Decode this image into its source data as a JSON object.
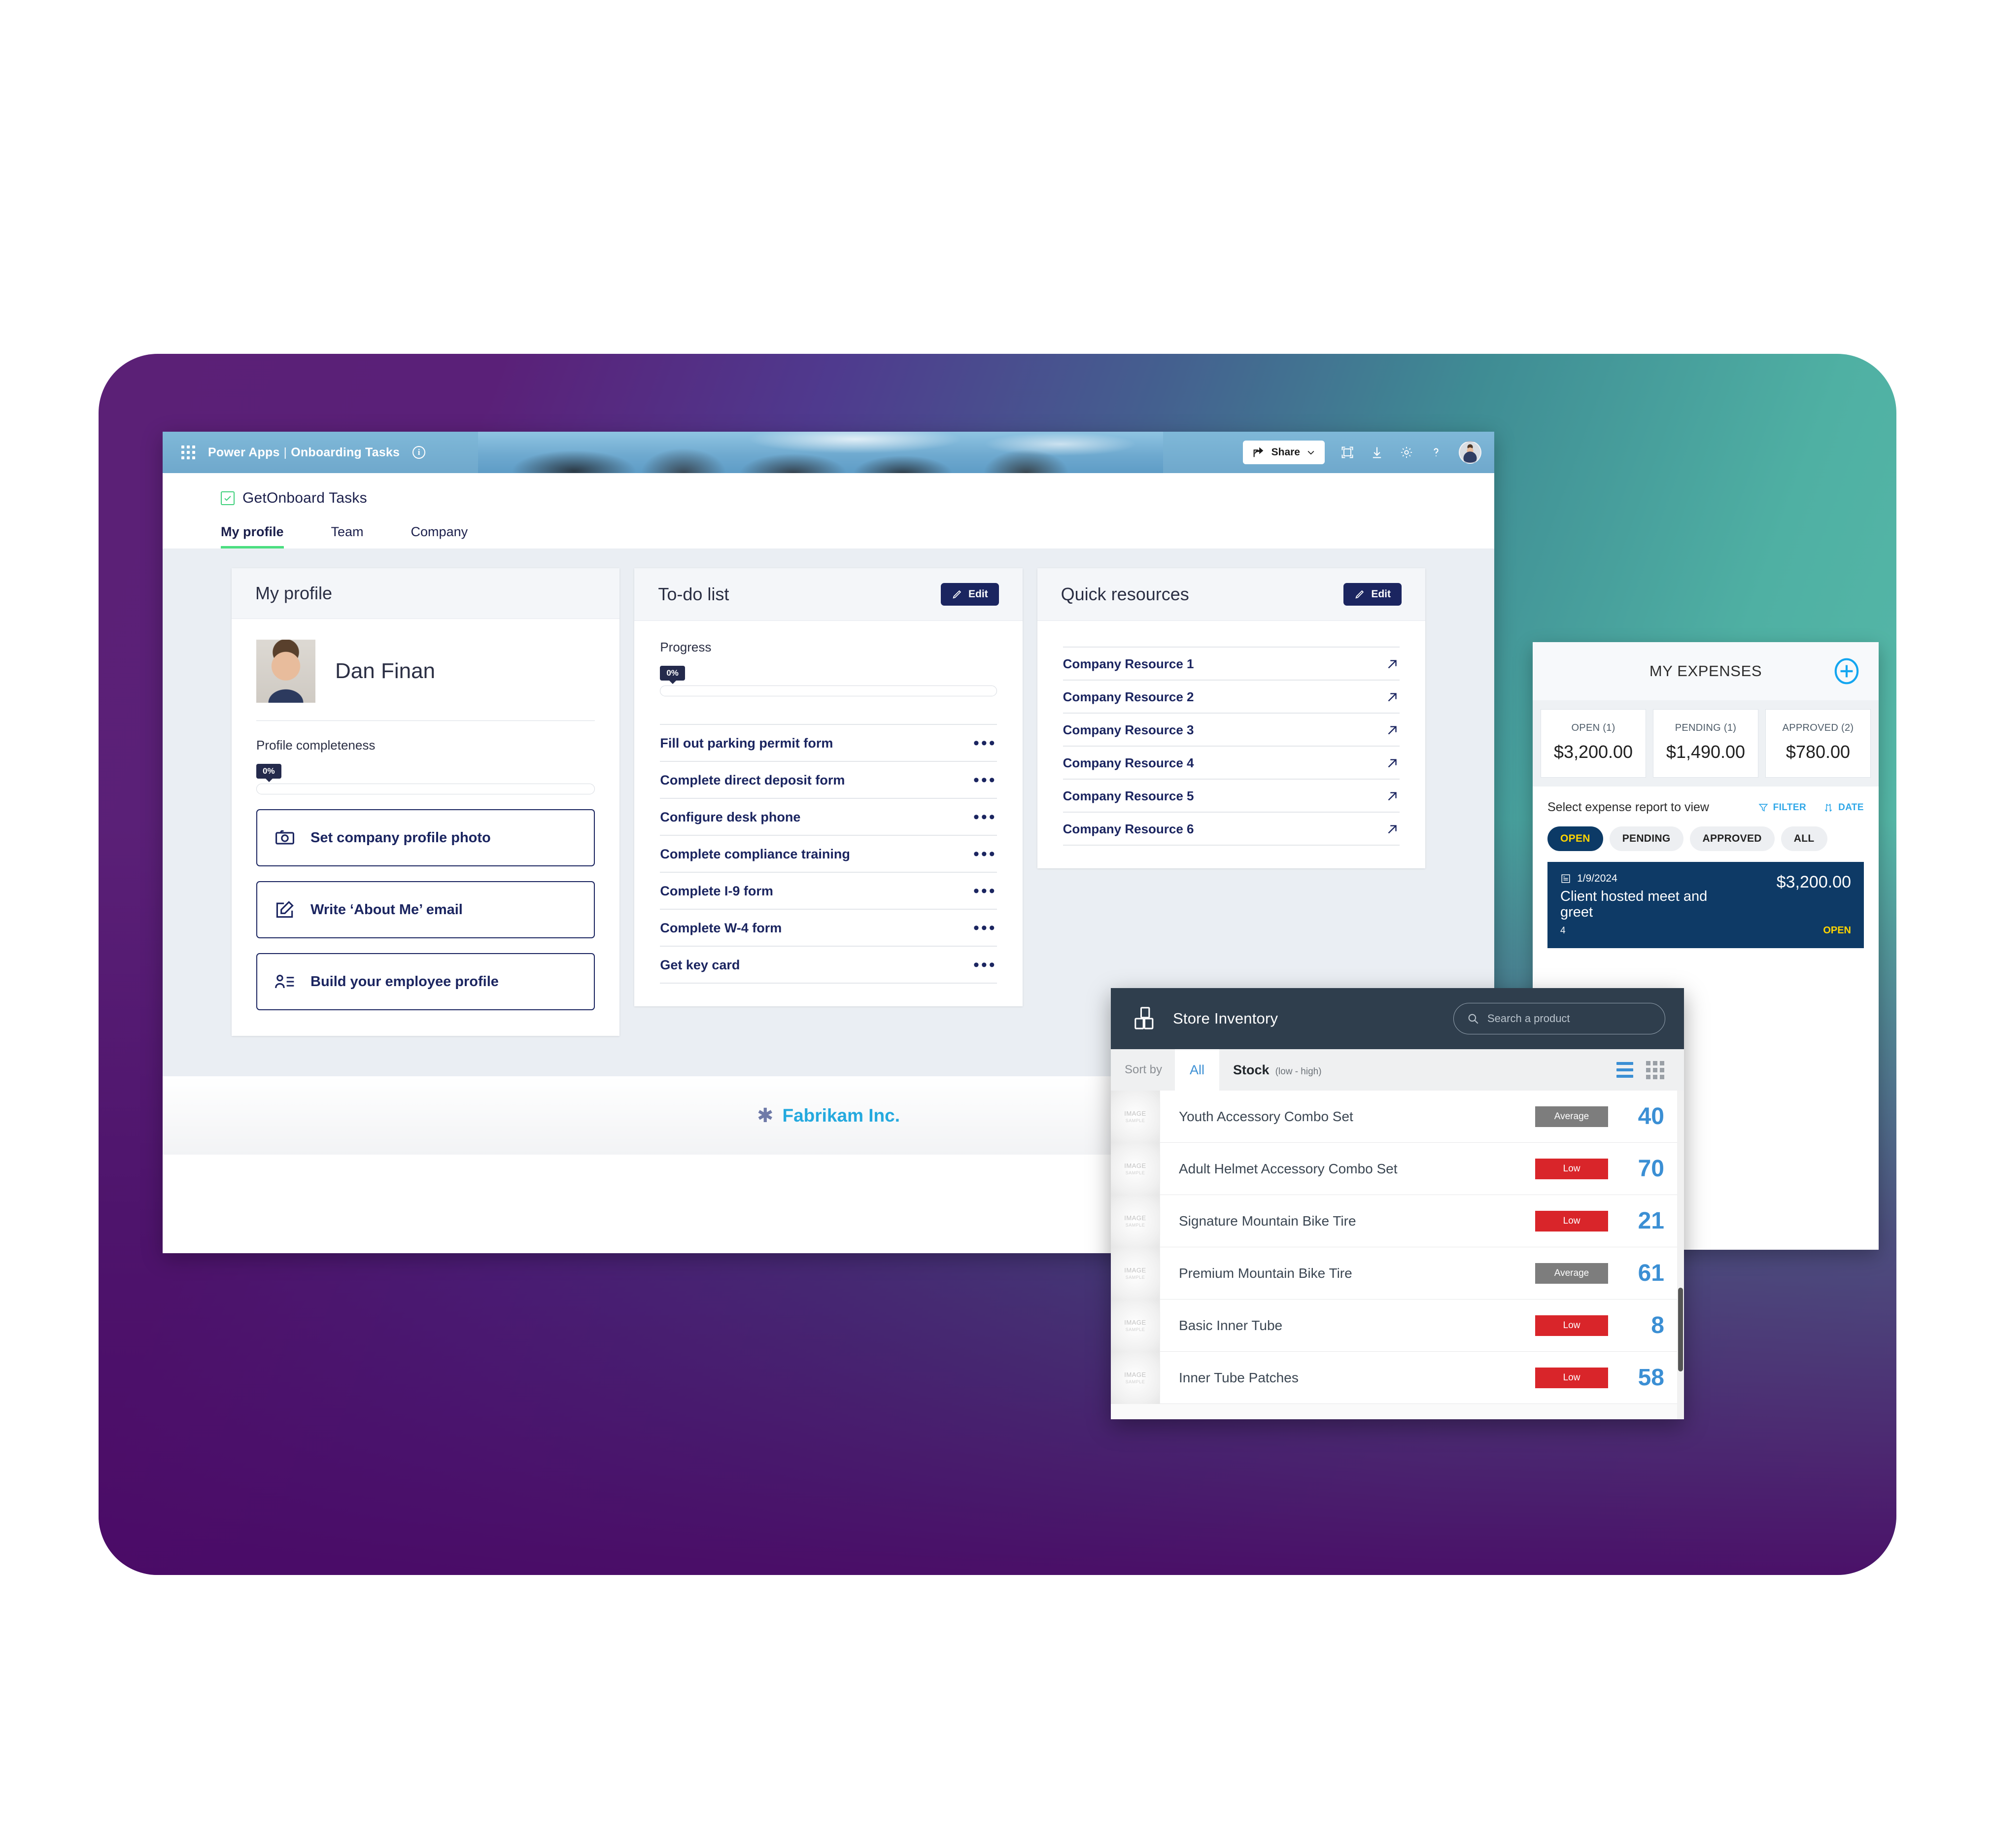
{
  "colors": {
    "brand_navy": "#1B2560",
    "accent_green": "#4BDE80",
    "accent_blue": "#3B8FD4",
    "expense_navy": "#0E3A66",
    "status_yellow": "#FFD400",
    "low_red": "#D9252A",
    "average_gray": "#7D7D7D",
    "footer_blue": "#24A9DE"
  },
  "app_window": {
    "banner": {
      "waffle_icon": "app-launcher-icon",
      "product": "Power Apps",
      "separator": "|",
      "app_name": "Onboarding Tasks",
      "info_icon": "info-icon",
      "share_label": "Share",
      "share_icon": "share-icon",
      "chevron_icon": "chevron-down-icon",
      "fullscreen_icon": "fullscreen-icon",
      "download_icon": "download-icon",
      "settings_icon": "gear-icon",
      "help_icon": "help-icon",
      "avatar_icon": "user-avatar"
    },
    "brand": {
      "check_icon": "checkbox-check-icon",
      "name": "GetOnboard Tasks"
    },
    "tabs": [
      {
        "label": "My profile",
        "active": true
      },
      {
        "label": "Team",
        "active": false
      },
      {
        "label": "Company",
        "active": false
      }
    ],
    "profile_card": {
      "title": "My profile",
      "user_name": "Dan Finan",
      "photo_icon": "profile-photo",
      "completeness_label": "Profile completeness",
      "completeness_value": "0%",
      "completeness_percent": 0,
      "actions": [
        {
          "label": "Set company profile photo",
          "icon": "camera-icon"
        },
        {
          "label": "Write ‘About Me’ email",
          "icon": "compose-icon"
        },
        {
          "label": "Build your employee profile",
          "icon": "contact-list-icon"
        }
      ]
    },
    "todo_card": {
      "title": "To-do list",
      "edit_label": "Edit",
      "edit_icon": "pencil-icon",
      "progress_label": "Progress",
      "progress_value": "0%",
      "progress_percent": 0,
      "items": [
        "Fill out parking permit form",
        "Complete direct deposit form",
        "Configure desk phone",
        "Complete compliance training",
        "Complete I-9 form",
        "Complete W-4 form",
        "Get key card"
      ],
      "row_menu_icon": "more-options-icon"
    },
    "resources_card": {
      "title": "Quick resources",
      "edit_label": "Edit",
      "edit_icon": "pencil-icon",
      "items": [
        "Company Resource 1",
        "Company Resource 2",
        "Company Resource 3",
        "Company Resource 4",
        "Company Resource 5",
        "Company Resource 6"
      ],
      "link_icon": "open-external-icon"
    },
    "footer": {
      "star_icon": "asterisk-icon",
      "company": "Fabrikam Inc."
    }
  },
  "expenses_panel": {
    "title": "MY EXPENSES",
    "add_icon": "plus-circle-icon",
    "tiles": [
      {
        "label": "OPEN (1)",
        "value": "$3,200.00"
      },
      {
        "label": "PENDING (1)",
        "value": "$1,490.00"
      },
      {
        "label": "APPROVED (2)",
        "value": "$780.00"
      }
    ],
    "select_label": "Select expense report to view",
    "tools": [
      {
        "label": "FILTER",
        "icon": "filter-icon"
      },
      {
        "label": "DATE",
        "icon": "sort-icon"
      }
    ],
    "chips": [
      {
        "label": "OPEN",
        "active": true
      },
      {
        "label": "PENDING",
        "active": false
      },
      {
        "label": "APPROVED",
        "active": false
      },
      {
        "label": "ALL",
        "active": false
      }
    ],
    "item": {
      "date_icon": "report-icon",
      "date": "1/9/2024",
      "name": "Client hosted meet and greet",
      "sub": "4",
      "amount": "$3,200.00",
      "status": "OPEN"
    }
  },
  "inventory_panel": {
    "logo_icon": "boxes-icon",
    "title": "Store Inventory",
    "search_placeholder": "Search a product",
    "search_icon": "search-icon",
    "sort_by_label": "Sort by",
    "sort_all_label": "All",
    "sort_field": "Stock",
    "sort_direction": "(low - high)",
    "list_view_icon": "list-view-icon",
    "grid_view_icon": "grid-view-icon",
    "thumb_line1": "IMAGE",
    "thumb_line2": "SAMPLE",
    "rows": [
      {
        "name": "Youth Accessory Combo Set",
        "badge": "Average",
        "badge_level": "average",
        "qty": "40"
      },
      {
        "name": "Adult Helmet Accessory Combo Set",
        "badge": "Low",
        "badge_level": "low",
        "qty": "70"
      },
      {
        "name": "Signature Mountain Bike Tire",
        "badge": "Low",
        "badge_level": "low",
        "qty": "21"
      },
      {
        "name": "Premium Mountain Bike Tire",
        "badge": "Average",
        "badge_level": "average",
        "qty": "61"
      },
      {
        "name": "Basic Inner Tube",
        "badge": "Low",
        "badge_level": "low",
        "qty": "8"
      },
      {
        "name": "Inner Tube Patches",
        "badge": "Low",
        "badge_level": "low",
        "qty": "58"
      }
    ]
  }
}
